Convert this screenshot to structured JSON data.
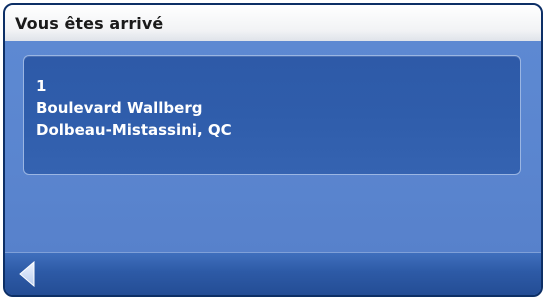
{
  "header": {
    "title": "Vous êtes arrivé"
  },
  "address": {
    "line1": "1",
    "line2": "Boulevard Wallberg",
    "line3": "Dolbeau-Mistassini, QC"
  },
  "footer": {
    "back_icon": "left-arrow-icon"
  },
  "colors": {
    "frame": "#0d2f66",
    "background": "#5a86cf",
    "card": "#2f5dab",
    "bottom_bar": "#2d5aa6"
  }
}
